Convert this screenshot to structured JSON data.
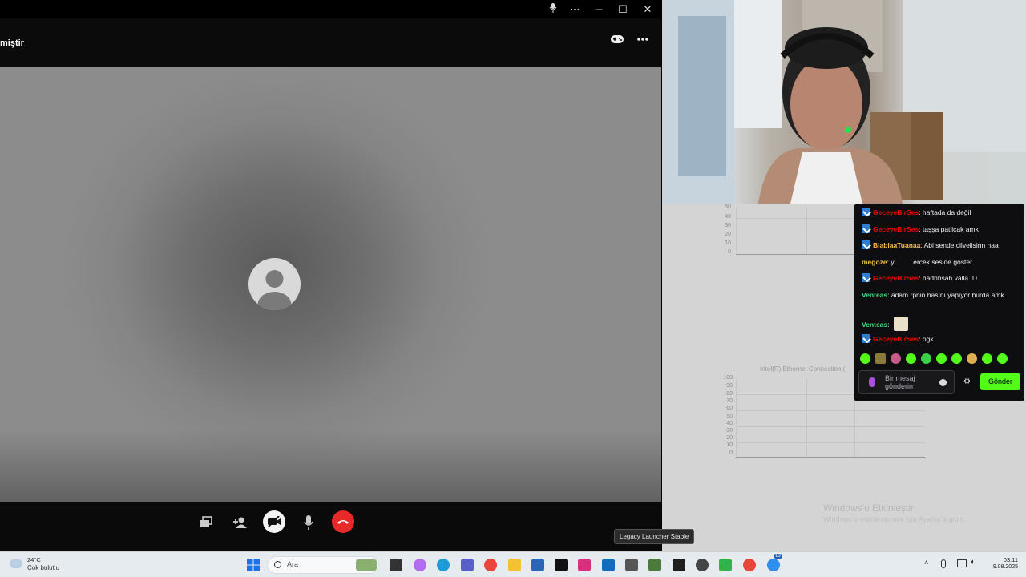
{
  "call": {
    "title": "miştir",
    "window_controls": [
      "mic-icon",
      "more-icon",
      "minimize",
      "maximize",
      "close"
    ]
  },
  "chat": {
    "messages": [
      {
        "user": "GeceyeBirSes",
        "text": ": haftada da değil",
        "color": "#eb0400",
        "badge": true
      },
      {
        "user": "GeceyeBirSes",
        "text": ": taşşa patlicak amk",
        "color": "#eb0400",
        "badge": true
      },
      {
        "user": "BlablaaTuanaa",
        "text": ": Abi sende cilvelisinn haa",
        "color": "#f2b84a",
        "badge": true
      },
      {
        "user": "megoze",
        "text": ": y          ercek seside goster",
        "color": "#f2b84a",
        "badge": false
      },
      {
        "user": "GeceyeBirSes",
        "text": ": hadhhsah valla :D",
        "color": "#eb0400",
        "badge": true
      },
      {
        "user": "Venteas",
        "text": ": adam rpnin hasını yapıyor burda amk",
        "color": "#3ddc84",
        "badge": false
      },
      {
        "user": "Venteas",
        "text": ":",
        "color": "#3ddc84",
        "badge": false
      },
      {
        "user": "GeceyeBirSes",
        "text": ": öğk",
        "color": "#eb0400",
        "badge": true
      }
    ],
    "input_placeholder": "Bir mesaj gönderin",
    "send_label": "Gönder"
  },
  "desktop": {
    "graph1_ticks": [
      "50",
      "40",
      "30",
      "20",
      "10",
      "0"
    ],
    "graph2_title": "Intel(R) Ethernet Connection (",
    "graph2_ticks": [
      "100",
      "90",
      "80",
      "70",
      "60",
      "50",
      "40",
      "30",
      "20",
      "10",
      "0"
    ],
    "watermark_title": "Windows'u Etkinleştir",
    "watermark_sub": "Windows'u etkinleştirmek için Ayarlar'a gidin.",
    "tooltip": "Legacy Launcher Stable"
  },
  "taskbar": {
    "weather_temp": "24°C",
    "weather_desc": "Çok bulutlu",
    "search_placeholder": "Ara",
    "time": "03:11",
    "date": "9.08.2025",
    "messenger_badge": "13"
  }
}
